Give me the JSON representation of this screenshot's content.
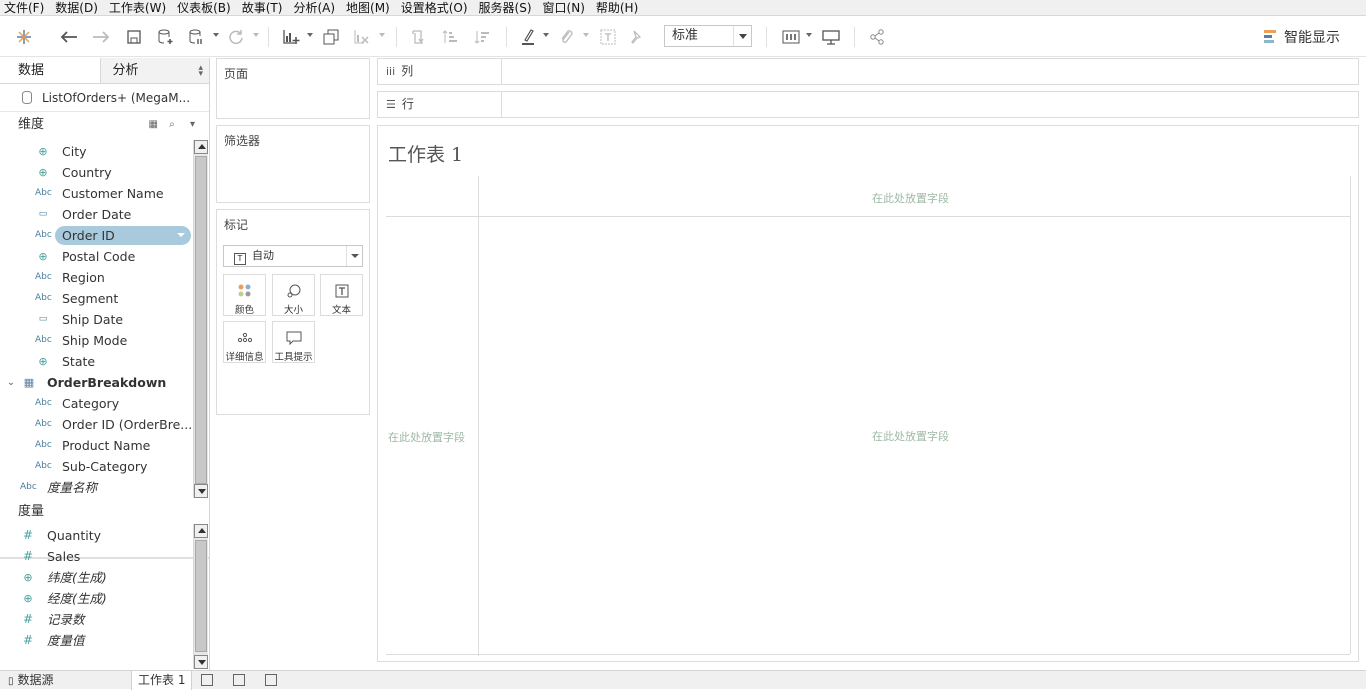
{
  "menu": [
    "文件(F)",
    "数据(D)",
    "工作表(W)",
    "仪表板(B)",
    "故事(T)",
    "分析(A)",
    "地图(M)",
    "设置格式(O)",
    "服务器(S)",
    "窗口(N)",
    "帮助(H)"
  ],
  "toolbar": {
    "fit_value": "标准",
    "show_me": "智能显示"
  },
  "data_pane": {
    "tabs": [
      "数据",
      "分析"
    ],
    "datasource": "ListOfOrders+ (MegaM...",
    "dimensions_title": "维度",
    "measures_title": "度量",
    "dimensions": [
      {
        "label": "City",
        "type": "geo"
      },
      {
        "label": "Country",
        "type": "geo"
      },
      {
        "label": "Customer Name",
        "type": "abc"
      },
      {
        "label": "Order Date",
        "type": "date"
      },
      {
        "label": "Order ID",
        "type": "abc"
      },
      {
        "label": "Postal Code",
        "type": "geo"
      },
      {
        "label": "Region",
        "type": "abc"
      },
      {
        "label": "Segment",
        "type": "abc"
      },
      {
        "label": "Ship Date",
        "type": "date"
      },
      {
        "label": "Ship Mode",
        "type": "abc"
      },
      {
        "label": "State",
        "type": "geo"
      }
    ],
    "table2": "OrderBreakdown",
    "table2_dimensions": [
      {
        "label": "Category",
        "type": "abc"
      },
      {
        "label": "Order ID (OrderBre...",
        "type": "abc"
      },
      {
        "label": "Product Name",
        "type": "abc"
      },
      {
        "label": "Sub-Category",
        "type": "abc"
      }
    ],
    "measure_names": "度量名称",
    "measures": [
      {
        "label": "Quantity",
        "type": "num",
        "italic": false
      },
      {
        "label": "Sales",
        "type": "num",
        "italic": false
      },
      {
        "label": "纬度(生成)",
        "type": "geo",
        "italic": true
      },
      {
        "label": "经度(生成)",
        "type": "geo",
        "italic": true
      },
      {
        "label": "记录数",
        "type": "num",
        "italic": true
      },
      {
        "label": "度量值",
        "type": "num",
        "italic": true
      }
    ]
  },
  "cards": {
    "pages": "页面",
    "filters": "筛选器",
    "marks": "标记",
    "mark_type": "自动",
    "mark_buttons": [
      "颜色",
      "大小",
      "文本",
      "详细信息",
      "工具提示"
    ]
  },
  "shelves": {
    "columns": "列",
    "rows": "行"
  },
  "view": {
    "title": "工作表 1",
    "drop_hint": "在此处放置字段"
  },
  "bottom_tabs": {
    "datasource": "数据源",
    "sheet": "工作表 1"
  }
}
